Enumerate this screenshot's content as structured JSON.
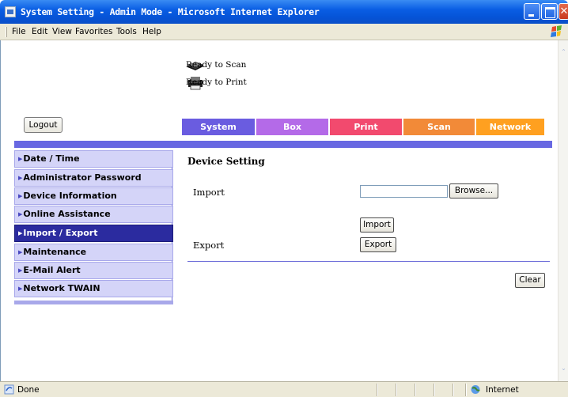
{
  "window": {
    "title": "System Setting - Admin Mode - Microsoft Internet Explorer"
  },
  "menu": [
    "File",
    "Edit",
    "View",
    "Favorites",
    "Tools",
    "Help"
  ],
  "device_status": {
    "scan": "Ready to Scan",
    "print": "Ready to Print"
  },
  "logout_label": "Logout",
  "tabs": [
    {
      "label": "System",
      "color": "#6a5ce0"
    },
    {
      "label": "Box",
      "color": "#b46ae8"
    },
    {
      "label": "Print",
      "color": "#f24a6e"
    },
    {
      "label": "Scan",
      "color": "#f28a38"
    },
    {
      "label": "Network",
      "color": "#ffa020"
    }
  ],
  "sidebar": {
    "items": [
      {
        "label": "Date / Time"
      },
      {
        "label": "Administrator Password"
      },
      {
        "label": "Device Information"
      },
      {
        "label": "Online Assistance"
      },
      {
        "label": "Import / Export",
        "selected": true
      },
      {
        "label": "Maintenance"
      },
      {
        "label": "E-Mail Alert"
      },
      {
        "label": "Network TWAIN"
      }
    ]
  },
  "main": {
    "section_title": "Device Setting",
    "import_label": "Import",
    "export_label": "Export",
    "file_value": "",
    "browse_label": "Browse...",
    "import_button": "Import",
    "export_button": "Export",
    "clear_button": "Clear"
  },
  "statusbar": {
    "text": "Done",
    "zone": "Internet"
  }
}
